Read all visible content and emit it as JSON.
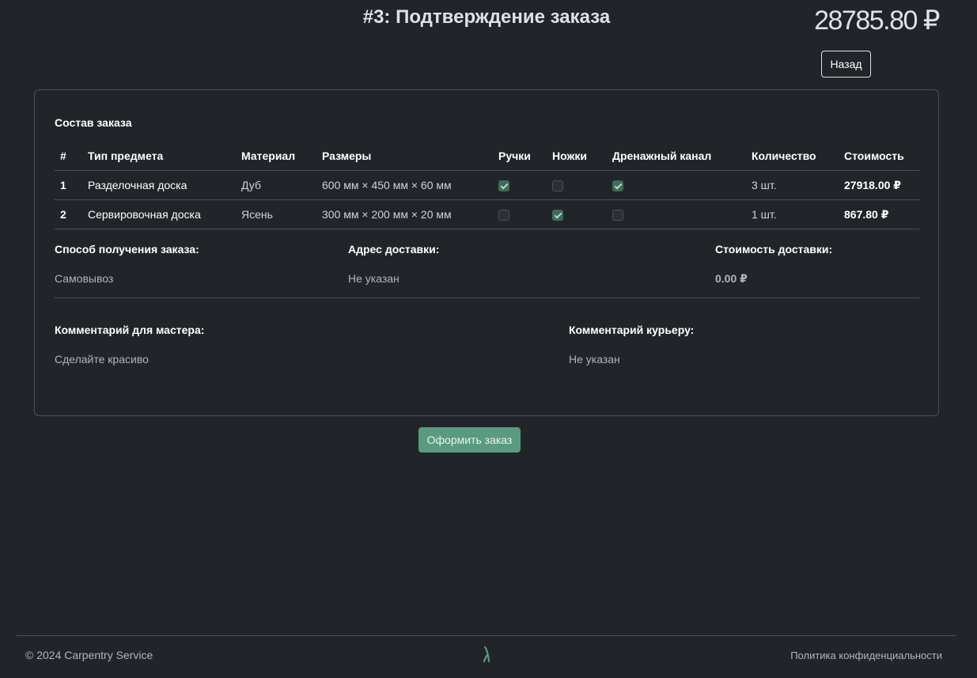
{
  "header": {
    "title": "#3: Подтверждение заказа",
    "total_price": "28785.80 ₽",
    "back_label": "Назад"
  },
  "order": {
    "section_title": "Состав заказа",
    "columns": [
      "#",
      "Тип предмета",
      "Материал",
      "Размеры",
      "Ручки",
      "Ножки",
      "Дренажный канал",
      "Количество",
      "Стоимость"
    ],
    "rows": [
      {
        "num": "1",
        "type": "Разделочная доска",
        "material": "Дуб",
        "size": "600 мм × 450 мм × 60 мм",
        "handles": true,
        "legs": false,
        "drain": true,
        "qty": "3 шт.",
        "cost": "27918.00 ₽"
      },
      {
        "num": "2",
        "type": "Сервировочная доска",
        "material": "Ясень",
        "size": "300 мм × 200 мм × 20 мм",
        "handles": false,
        "legs": true,
        "drain": false,
        "qty": "1 шт.",
        "cost": "867.80 ₽"
      }
    ]
  },
  "delivery": {
    "method_label": "Способ получения заказа:",
    "method_value": "Самовывоз",
    "address_label": "Адрес доставки:",
    "address_value": "Не указан",
    "cost_label": "Стоимость доставки:",
    "cost_value": "0.00 ₽"
  },
  "comments": {
    "master_label": "Комментарий для мастера:",
    "master_value": "Сделайте красиво",
    "courier_label": "Комментарий курьеру:",
    "courier_value": "Не указан"
  },
  "submit_label": "Оформить заказ",
  "footer": {
    "copyright": "© 2024 Carpentry Service",
    "privacy": "Политика конфиденциальности",
    "logo_icon": "leaf-logo-icon"
  },
  "colors": {
    "background": "#212529",
    "accent": "#5a9b7f",
    "checkbox_on": "#3e6b59"
  }
}
